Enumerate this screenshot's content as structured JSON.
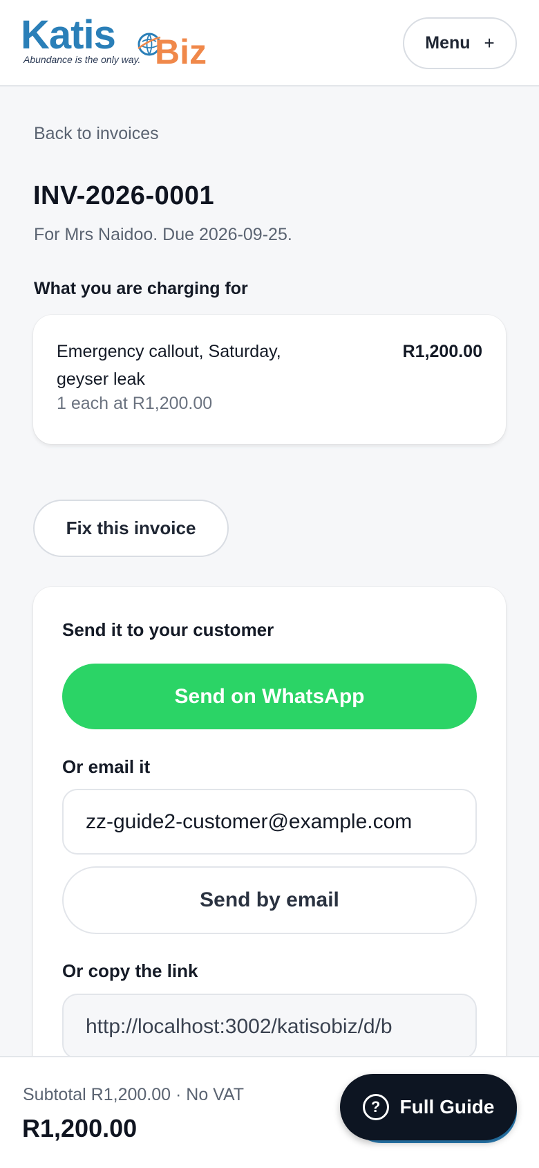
{
  "brand": {
    "name_part1": "Katis",
    "name_part2": "Biz",
    "tagline": "Abundance is the only way.",
    "colors": {
      "primary": "#2a7fb8",
      "accent": "#f0884a"
    }
  },
  "header": {
    "menu_label": "Menu",
    "menu_icon": "+"
  },
  "nav": {
    "back_label": "Back to invoices"
  },
  "invoice": {
    "number": "INV-2026-0001",
    "subtitle": "For Mrs Naidoo. Due 2026-09-25.",
    "items_heading": "What you are charging for",
    "items": [
      {
        "description": "Emergency callout, Saturday, geyser leak",
        "amount": "R1,200.00",
        "meta": "1 each at R1,200.00"
      }
    ],
    "fix_label": "Fix this invoice"
  },
  "send": {
    "heading": "Send it to your customer",
    "whatsapp_label": "Send on WhatsApp",
    "whatsapp_color": "#2bd466",
    "email_heading": "Or email it",
    "email_value": "zz-guide2-customer@example.com",
    "email_button": "Send by email",
    "link_heading": "Or copy the link",
    "link_value": "http://localhost:3002/katisobiz/d/b"
  },
  "footer": {
    "subtotal_line": "Subtotal R1,200.00 · No VAT",
    "total": "R1,200.00",
    "guide_label": "Full Guide",
    "guide_icon": "question-circle-icon"
  }
}
